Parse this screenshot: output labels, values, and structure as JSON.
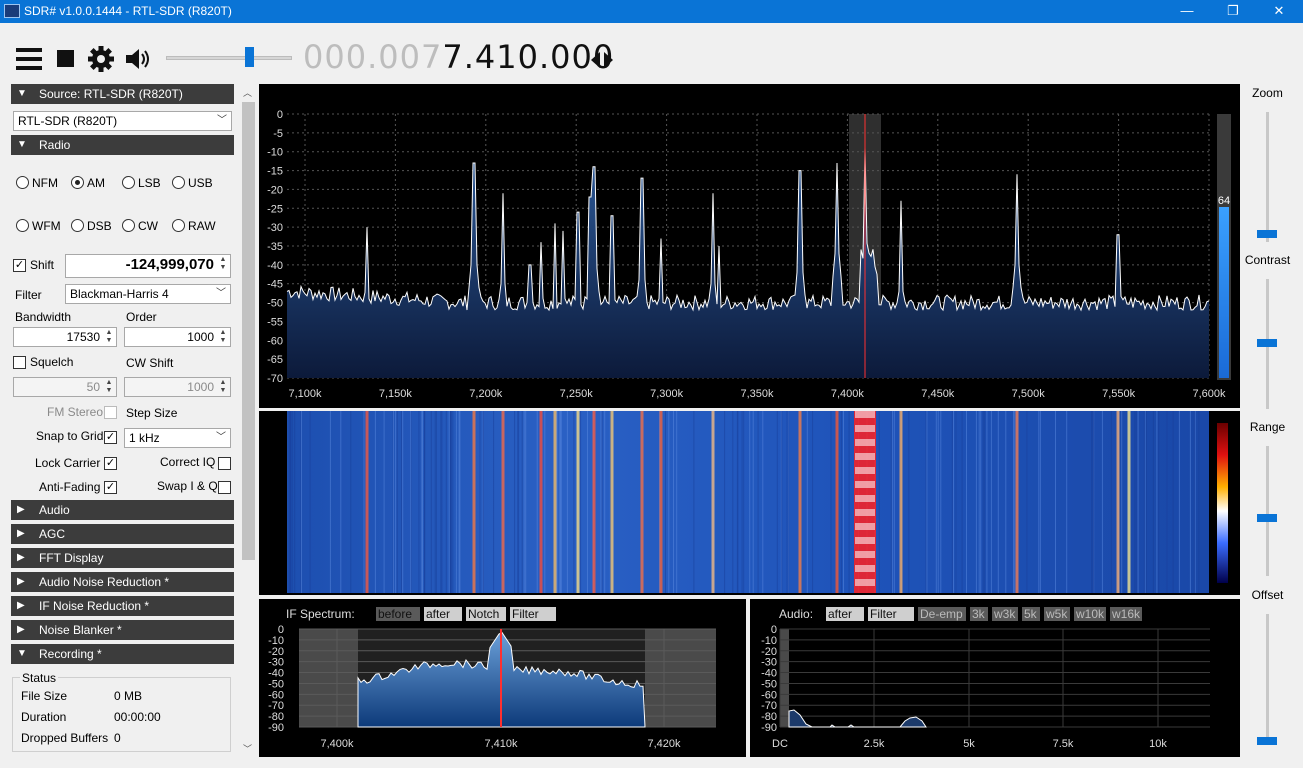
{
  "titlebar": {
    "title": "SDR# v1.0.0.1444 - RTL-SDR (R820T)",
    "minimize": "—",
    "maximize": "❐",
    "close": "✕"
  },
  "toolbar": {
    "freq_dim": "000.007",
    "freq_bright": "7.410.000",
    "volume_level": 0.68
  },
  "source": {
    "header": "Source: RTL-SDR (R820T)",
    "device": "RTL-SDR (R820T)"
  },
  "radio": {
    "header": "Radio",
    "modes": [
      "NFM",
      "AM",
      "LSB",
      "USB",
      "WFM",
      "DSB",
      "CW",
      "RAW"
    ],
    "selected_mode": "AM",
    "shift_label": "Shift",
    "shift_value": "-124,999,070",
    "filter_label": "Filter",
    "filter_value": "Blackman-Harris 4",
    "bandwidth_label": "Bandwidth",
    "bandwidth_value": "17530",
    "order_label": "Order",
    "order_value": "1000",
    "squelch_label": "Squelch",
    "squelch_value": "50",
    "cwshift_label": "CW Shift",
    "cwshift_value": "1000",
    "fmstereo_label": "FM Stereo",
    "stepsize_label": "Step Size",
    "snap_label": "Snap to Grid",
    "step_value": "1 kHz",
    "lockcarrier_label": "Lock Carrier",
    "correctiq_label": "Correct IQ",
    "antifading_label": "Anti-Fading",
    "swapiq_label": "Swap I & Q"
  },
  "sections": [
    "Audio",
    "AGC",
    "FFT Display",
    "Audio Noise Reduction *",
    "IF Noise Reduction *",
    "Noise Blanker *"
  ],
  "recording": {
    "header": "Recording *",
    "status_label": "Status",
    "rows": [
      {
        "label": "File Size",
        "value": "0 MB"
      },
      {
        "label": "Duration",
        "value": "00:00:00"
      },
      {
        "label": "Dropped Buffers",
        "value": "0"
      }
    ]
  },
  "spectrum": {
    "y_ticks": [
      "0",
      "-5",
      "-10",
      "-15",
      "-20",
      "-25",
      "-30",
      "-35",
      "-40",
      "-45",
      "-50",
      "-55",
      "-60",
      "-65",
      "-70"
    ],
    "x_ticks": [
      "7,100k",
      "7,150k",
      "7,200k",
      "7,250k",
      "7,300k",
      "7,350k",
      "7,400k",
      "7,450k",
      "7,500k",
      "7,550k",
      "7,600k"
    ],
    "level_value": "64"
  },
  "if_spectrum": {
    "label": "IF Spectrum:",
    "tags": [
      "before",
      "after",
      "Notch",
      "Filter"
    ],
    "y_ticks": [
      "0",
      "-10",
      "-20",
      "-30",
      "-40",
      "-50",
      "-60",
      "-70",
      "-80",
      "-90"
    ],
    "x_ticks": [
      "7,400k",
      "7,410k",
      "7,420k"
    ]
  },
  "audio_spectrum": {
    "label": "Audio:",
    "tags": [
      "after",
      "Filter",
      "De-emp",
      "3k",
      "w3k",
      "5k",
      "w5k",
      "w10k",
      "w16k"
    ],
    "y_ticks": [
      "0",
      "-10",
      "-20",
      "-30",
      "-40",
      "-50",
      "-60",
      "-70",
      "-80",
      "-90"
    ],
    "x_ticks": [
      "DC",
      "2.5k",
      "5k",
      "7.5k",
      "10k"
    ]
  },
  "right_panel": {
    "zoom": "Zoom",
    "contrast": "Contrast",
    "range": "Range",
    "offset": "Offset"
  }
}
